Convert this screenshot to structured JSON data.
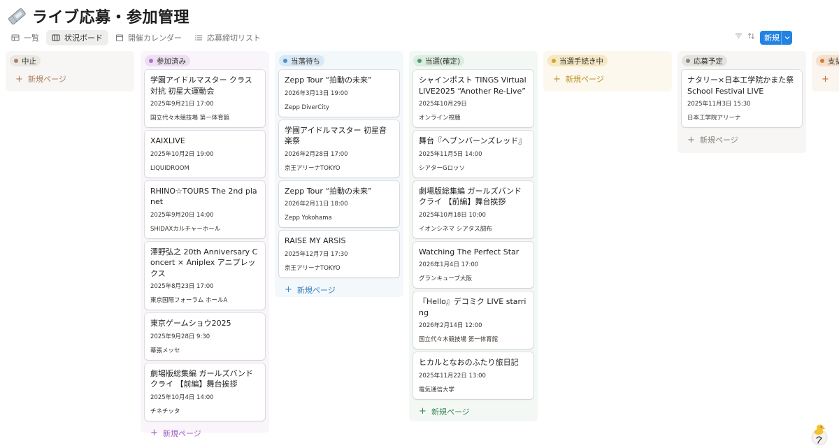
{
  "page": {
    "title": "ライブ応募・参加管理",
    "icon": "ticket-icon"
  },
  "views": [
    {
      "label": "一覧",
      "icon": "table-icon",
      "active": false
    },
    {
      "label": "状況ボード",
      "icon": "board-icon",
      "active": true
    },
    {
      "label": "開催カレンダー",
      "icon": "calendar-icon",
      "active": false
    },
    {
      "label": "応募締切リスト",
      "icon": "list-icon",
      "active": false
    }
  ],
  "toolbar": {
    "icons": [
      "filter-icon",
      "sort-icon",
      "automation-icon",
      "search-icon",
      "settings-icon"
    ],
    "new_label": "新規"
  },
  "new_page_label": "新規ページ",
  "columns": [
    {
      "key": "cancel",
      "label": "中止",
      "pill_bg": "#ebe7e3",
      "dot": "#a6826a",
      "new_color": "#b07d5b",
      "cards": []
    },
    {
      "key": "joined",
      "label": "参加済み",
      "pill_bg": "#ebdff1",
      "dot": "#b16fcd",
      "new_color": "#a05fbf",
      "cards": [
        {
          "title": "学園アイドルマスター クラス対抗 初星大運動会",
          "date": "2025年9月21日 17:00",
          "venue": "国立代々木競技場 第一体育館"
        },
        {
          "title": "XAIXLIVE",
          "date": "2025年10月2日 19:00",
          "venue": "LIQUIDROOM"
        },
        {
          "title": "RHINO☆TOURS The 2nd planet",
          "date": "2025年9月20日 14:00",
          "venue": "SHIDAXカルチャーホール"
        },
        {
          "title": "澤野弘之 20th Anniversary Concert × Aniplex アニプレックス",
          "date": "2025年8月23日 17:00",
          "venue": "東京国際フォーラム ホールA"
        },
        {
          "title": "東京ゲームショウ2025",
          "date": "2025年9月28日 9:30",
          "venue": "幕張メッセ"
        },
        {
          "title": "劇場版総集編 ガールズバンドクライ 【前編】舞台挨拶",
          "date": "2025年10月4日 14:00",
          "venue": "チネチッタ"
        }
      ]
    },
    {
      "key": "waiting",
      "label": "当落待ち",
      "pill_bg": "#d8e8f5",
      "dot": "#4a90d0",
      "new_color": "#3c82c4",
      "cards": [
        {
          "title": "Zepp Tour “拍動の未来”",
          "date": "2026年3月13日 19:00",
          "venue": "Zepp DiverCity"
        },
        {
          "title": "学園アイドルマスター 初星音楽祭",
          "date": "2026年2月28日 17:00",
          "venue": "京王アリーナTOKYO"
        },
        {
          "title": "Zepp Tour “拍動の未来”",
          "date": "2026年2月11日 18:00",
          "venue": "Zepp Yokohama"
        },
        {
          "title": "RAISE MY ARSIS",
          "date": "2025年12月7日 17:30",
          "venue": "京王アリーナTOKYO"
        }
      ]
    },
    {
      "key": "won",
      "label": "当選(確定)",
      "pill_bg": "#dbece1",
      "dot": "#4f9a6c",
      "new_color": "#3f8a5c",
      "cards": [
        {
          "title": "シャインポスト TINGS Virtual LIVE2025 “Another Re-Live”",
          "date": "2025年10月29日",
          "venue": "オンライン視聴"
        },
        {
          "title": "舞台『ヘブンバーンズレッド』",
          "date": "2025年11月5日 14:00",
          "venue": "シアターGロッソ"
        },
        {
          "title": "劇場版総集編 ガールズバンドクライ 【前編】舞台挨拶",
          "date": "2025年10月18日 10:00",
          "venue": "イオンシネマ シアタス調布"
        },
        {
          "title": "Watching The Perfect Star",
          "date": "2026年1月4日 17:00",
          "venue": "グランキューブ大阪"
        },
        {
          "title": "『Hello』デコミク LIVE starring",
          "date": "2026年2月14日 12:00",
          "venue": "国立代々木競技場 第一体育館"
        },
        {
          "title": "ヒカルとなおのふたり旅日記",
          "date": "2025年11月22日 13:00",
          "venue": "電気通信大学"
        }
      ]
    },
    {
      "key": "procedure",
      "label": "当選手続き中",
      "pill_bg": "#f5e8c4",
      "dot": "#d6a526",
      "new_color": "#c09020",
      "cards": []
    },
    {
      "key": "planned",
      "label": "応募予定",
      "pill_bg": "#e5e3df",
      "dot": "#8a8680",
      "new_color": "#8a8680",
      "cards": [
        {
          "title": "ナタリー×日本工学院かまた祭 School Festival LIVE",
          "date": "2025年11月3日 15:30",
          "venue": "日本工学院アリーナ"
        }
      ]
    },
    {
      "key": "pay",
      "label": "支払",
      "pill_bg": "#f5dfcd",
      "dot": "#d9793a",
      "new_color": "#c96f2e",
      "cards": []
    }
  ]
}
